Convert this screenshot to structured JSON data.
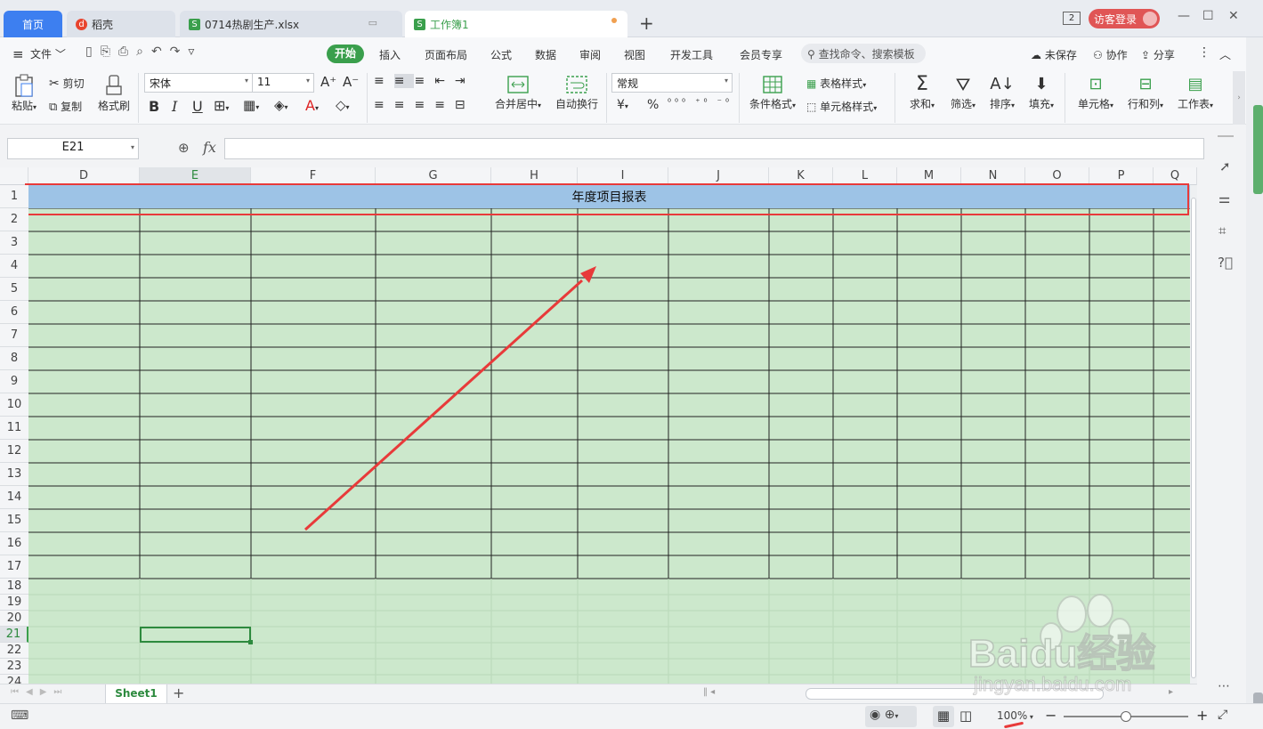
{
  "tabs": {
    "home": "首页",
    "daoke": "稻壳",
    "file": "0714热剧生产.xlsx",
    "workbook": "工作簿1",
    "add": "+"
  },
  "window": {
    "badge": "2",
    "login": "访客登录"
  },
  "menu": {
    "file": "文件",
    "items": [
      "开始",
      "插入",
      "页面布局",
      "公式",
      "数据",
      "审阅",
      "视图",
      "开发工具",
      "会员专享"
    ],
    "search_placeholder": "查找命令、搜索模板",
    "unsaved": "未保存",
    "collab": "协作",
    "share": "分享"
  },
  "toolbar": {
    "paste": "粘贴",
    "cut": "剪切",
    "copy": "复制",
    "format_painter": "格式刷",
    "font": "宋体",
    "size": "11",
    "merge": "合并居中",
    "wrap": "自动换行",
    "number_format": "常规",
    "currency": "¥",
    "percent": "%",
    "conditional": "条件格式",
    "table_style": "表格样式",
    "cell_style": "单元格样式",
    "sum": "求和",
    "filter": "筛选",
    "sort": "排序",
    "fill": "填充",
    "cell": "单元格",
    "rowcol": "行和列",
    "worksheet": "工作表"
  },
  "formula_bar": {
    "namebox": "E21",
    "fx": "fx",
    "value": ""
  },
  "grid": {
    "columns": [
      "D",
      "E",
      "F",
      "G",
      "H",
      "I",
      "J",
      "K",
      "L",
      "M",
      "N",
      "O",
      "P",
      "Q"
    ],
    "rows": [
      "1",
      "2",
      "3",
      "4",
      "5",
      "6",
      "7",
      "8",
      "9",
      "10",
      "11",
      "12",
      "13",
      "14",
      "15",
      "16",
      "17",
      "18",
      "19",
      "20",
      "21",
      "22",
      "23",
      "24"
    ],
    "title": "年度项目报表",
    "selected_cell": "E21"
  },
  "sheets": {
    "active": "Sheet1",
    "add": "+"
  },
  "status": {
    "zoom": "100%"
  },
  "watermark": {
    "brand": "Baidu经验",
    "url": "jingyan.baidu.com"
  },
  "colors": {
    "accent": "#3a9f4c",
    "title_fill": "#9dc3e6",
    "body_fill": "#cce8cc",
    "highlight": "#e83a3a"
  }
}
